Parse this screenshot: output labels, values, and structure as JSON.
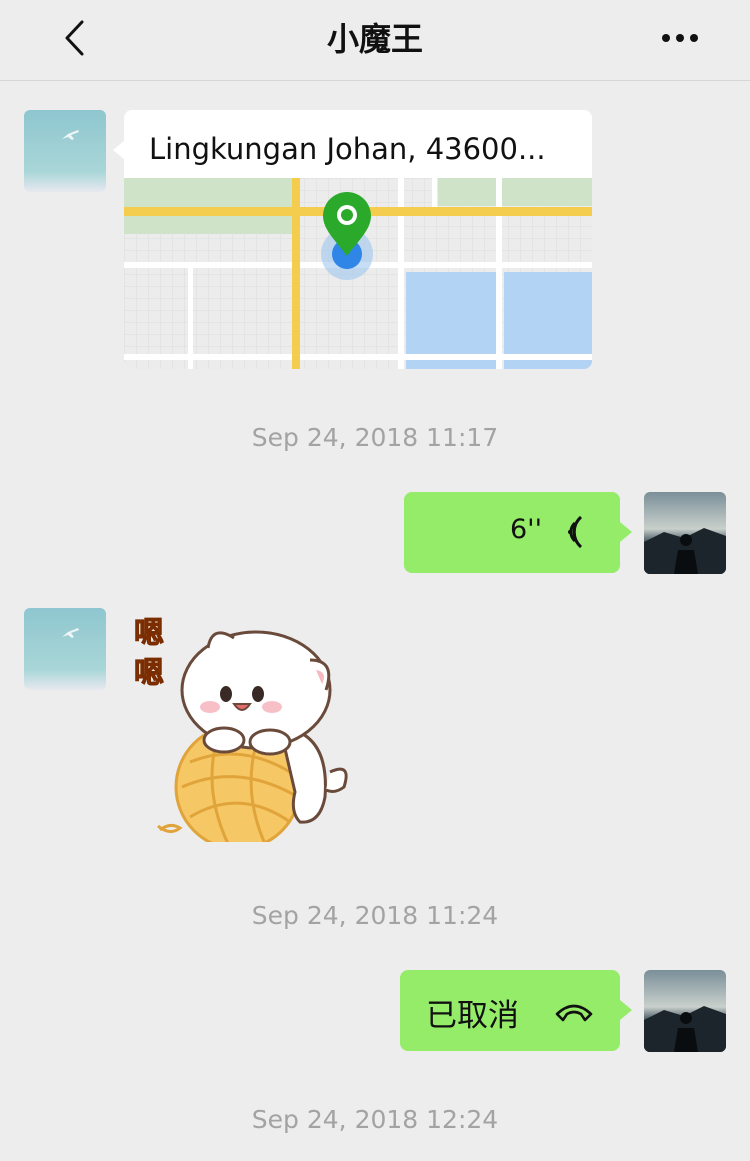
{
  "header": {
    "title": "小魔王",
    "back_icon": "chevron-left-icon",
    "more_icon": "ellipsis-icon"
  },
  "messages": {
    "location": {
      "title": "Lingkungan Johan, 43600..."
    },
    "timestamp_1": "Sep 24, 2018 11:17",
    "voice": {
      "duration": "6''",
      "icon": "voice-wave-icon"
    },
    "sticker": {
      "text": "嗯嗯",
      "icon": "cat-sticker-icon"
    },
    "timestamp_2": "Sep 24, 2018 11:24",
    "call": {
      "text": "已取消",
      "icon": "phone-hangup-icon"
    },
    "timestamp_3": "Sep 24, 2018 12:24"
  },
  "colors": {
    "bubble_green": "#95ec69",
    "background": "#ededed",
    "timestamp": "#a3a3a3"
  }
}
